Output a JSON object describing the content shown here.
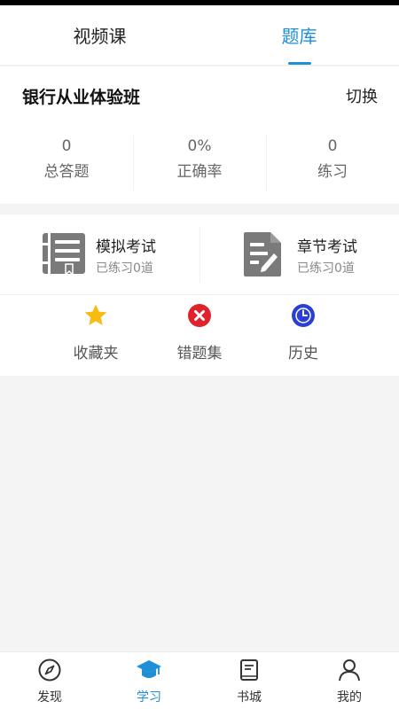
{
  "tabs": [
    {
      "label": "视频课",
      "active": false
    },
    {
      "label": "题库",
      "active": true
    }
  ],
  "course": {
    "name": "银行从业体验班",
    "switch_label": "切换"
  },
  "stats": [
    {
      "value": "0",
      "label": "总答题"
    },
    {
      "value": "0%",
      "label": "正确率"
    },
    {
      "value": "0",
      "label": "练习"
    }
  ],
  "modes": [
    {
      "title": "模拟考试",
      "subtitle": "已练习0道",
      "icon": "book-icon"
    },
    {
      "title": "章节考试",
      "subtitle": "已练习0道",
      "icon": "document-edit-icon"
    }
  ],
  "quick": [
    {
      "label": "收藏夹",
      "icon": "star-icon",
      "color": "#f7bb12"
    },
    {
      "label": "错题集",
      "icon": "error-x-icon",
      "color": "#e0222c"
    },
    {
      "label": "历史",
      "icon": "clock-icon",
      "color": "#2b3fd6"
    }
  ],
  "nav": [
    {
      "label": "发现",
      "icon": "compass-icon",
      "active": false
    },
    {
      "label": "学习",
      "icon": "graduation-cap-icon",
      "active": true
    },
    {
      "label": "书城",
      "icon": "book-shelf-icon",
      "active": false
    },
    {
      "label": "我的",
      "icon": "user-icon",
      "active": false
    }
  ],
  "colors": {
    "accent": "#1e8fd6"
  }
}
